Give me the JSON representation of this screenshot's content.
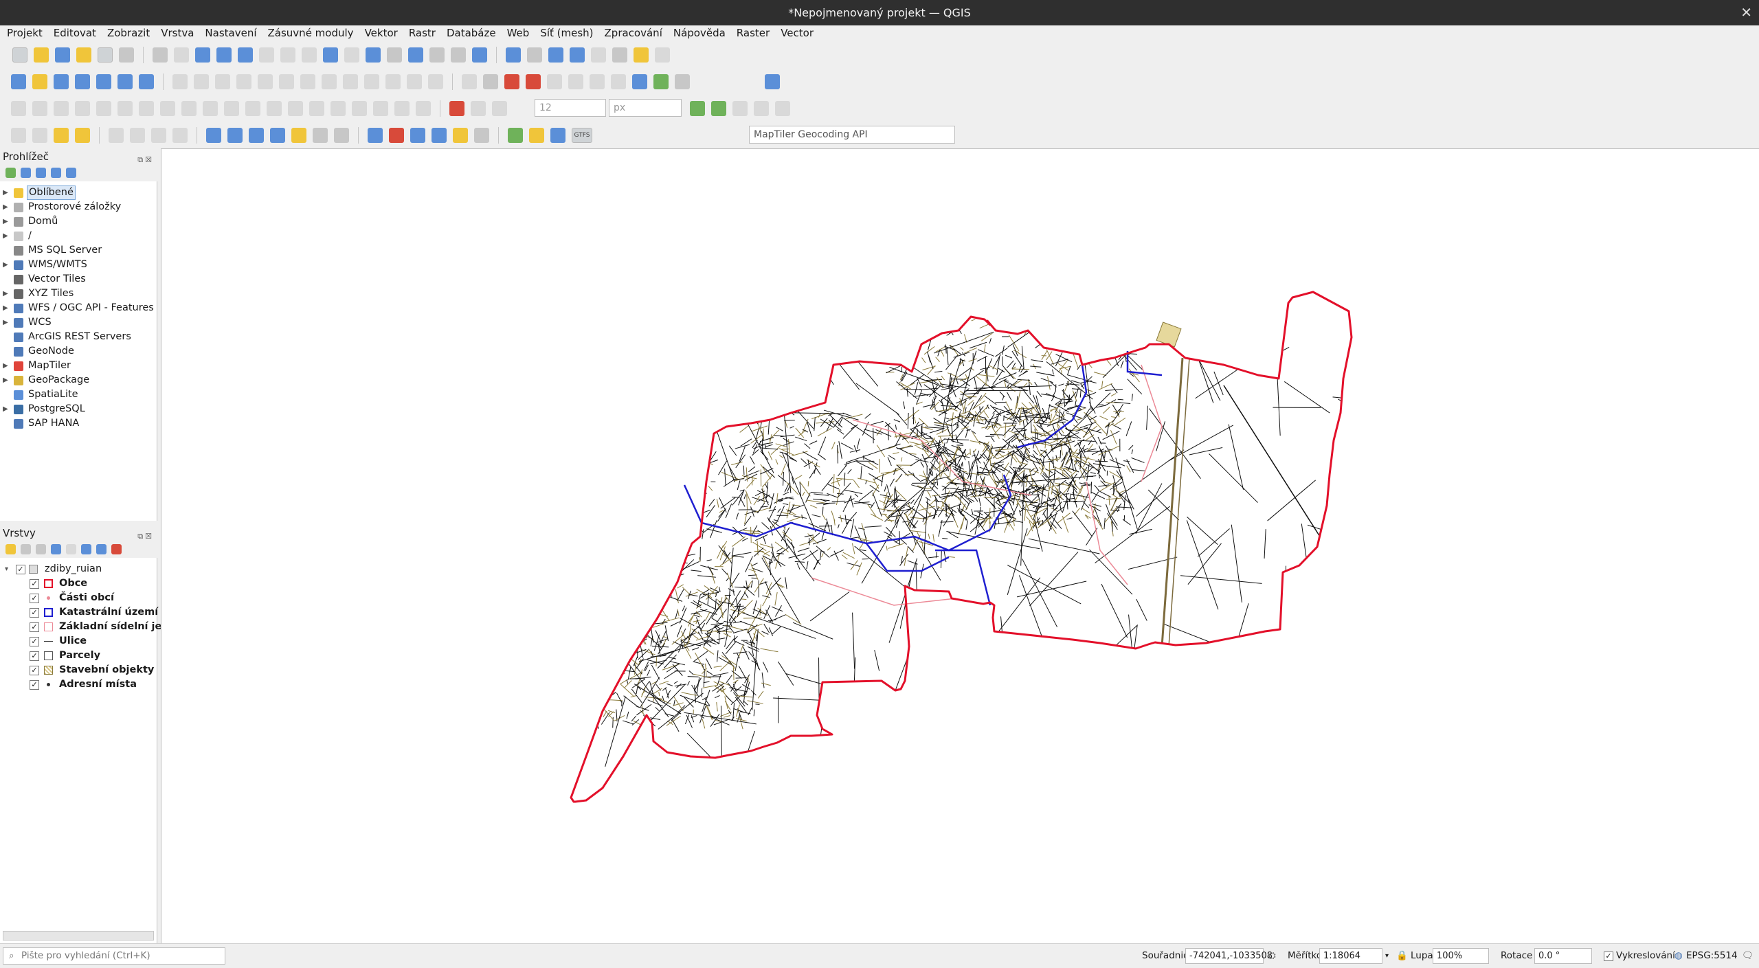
{
  "window": {
    "title": "*Nepojmenovaný projekt — QGIS",
    "close": "✕"
  },
  "menu": [
    "Projekt",
    "Editovat",
    "Zobrazit",
    "Vrstva",
    "Nastavení",
    "Zásuvné moduly",
    "Vektor",
    "Rastr",
    "Databáze",
    "Web",
    "Síť (mesh)",
    "Zpracování",
    "Nápověda",
    "Raster",
    "Vector"
  ],
  "toolbar": {
    "snapping_tolerance": "12",
    "snapping_units": "px",
    "geocoder_placeholder": "MapTiler Geocoding API",
    "gtfs_label": "GTFS"
  },
  "browser_panel": {
    "title": "Prohlížeč",
    "items": [
      {
        "label": "Oblíbené",
        "icon": "star-icon",
        "expandable": true,
        "selected": true
      },
      {
        "label": "Prostorové záložky",
        "icon": "bookmark-icon",
        "expandable": true
      },
      {
        "label": "Domů",
        "icon": "home-folder-icon",
        "expandable": true
      },
      {
        "label": "/",
        "icon": "folder-icon",
        "expandable": true
      },
      {
        "label": "MS SQL Server",
        "icon": "mssql-icon",
        "expandable": false
      },
      {
        "label": "WMS/WMTS",
        "icon": "wms-icon",
        "expandable": true
      },
      {
        "label": "Vector Tiles",
        "icon": "vector-tiles-icon",
        "expandable": false
      },
      {
        "label": "XYZ Tiles",
        "icon": "xyz-tiles-icon",
        "expandable": true
      },
      {
        "label": "WFS / OGC API - Features",
        "icon": "wfs-icon",
        "expandable": true
      },
      {
        "label": "WCS",
        "icon": "wcs-icon",
        "expandable": true
      },
      {
        "label": "ArcGIS REST Servers",
        "icon": "arcgis-icon",
        "expandable": false
      },
      {
        "label": "GeoNode",
        "icon": "geonode-icon",
        "expandable": false
      },
      {
        "label": "MapTiler",
        "icon": "maptiler-icon",
        "expandable": true
      },
      {
        "label": "GeoPackage",
        "icon": "geopackage-icon",
        "expandable": true
      },
      {
        "label": "SpatiaLite",
        "icon": "spatialite-icon",
        "expandable": false
      },
      {
        "label": "PostgreSQL",
        "icon": "postgresql-icon",
        "expandable": true
      },
      {
        "label": "SAP HANA",
        "icon": "saphana-icon",
        "expandable": false
      }
    ]
  },
  "layers_panel": {
    "title": "Vrstvy",
    "group": {
      "label": "zdiby_ruian",
      "checked": "✓"
    },
    "layers": [
      {
        "label": "Obce",
        "symbol": "polygon-red-outline",
        "checked": "✓"
      },
      {
        "label": "Části obcí",
        "symbol": "point-pink",
        "checked": "✓"
      },
      {
        "label": "Katastrální území",
        "symbol": "polygon-blue-outline",
        "checked": "✓"
      },
      {
        "label": "Základní sídelní jedn",
        "symbol": "polygon-pink-outline",
        "checked": "✓"
      },
      {
        "label": "Ulice",
        "symbol": "line-dark",
        "checked": "✓"
      },
      {
        "label": "Parcely",
        "symbol": "polygon-gray-outline",
        "checked": "✓"
      },
      {
        "label": "Stavební objekty",
        "symbol": "polygon-hatched-brown",
        "checked": "✓"
      },
      {
        "label": "Adresní místa",
        "symbol": "point-dark",
        "checked": "✓"
      }
    ]
  },
  "colors": {
    "obce": "#e3102a",
    "katastr": "#1f1fd0",
    "zsj": "#ec8a97",
    "parcely": "#111111",
    "stavby": "#8a7a3a",
    "ulice": "#7c6a3c"
  },
  "status": {
    "search_placeholder": "Pište pro vyhledání (Ctrl+K)",
    "coord_label": "Souřadnice",
    "coord_value": "-742041,-1033508",
    "scale_label": "Měřítko",
    "scale_value": "1:18064",
    "magnifier_label": "Lupa",
    "magnifier_value": "100%",
    "rotation_label": "Rotace",
    "rotation_value": "0.0 °",
    "render_label": "Vykreslování",
    "render_checked": "✓",
    "crs": "EPSG:5514"
  }
}
